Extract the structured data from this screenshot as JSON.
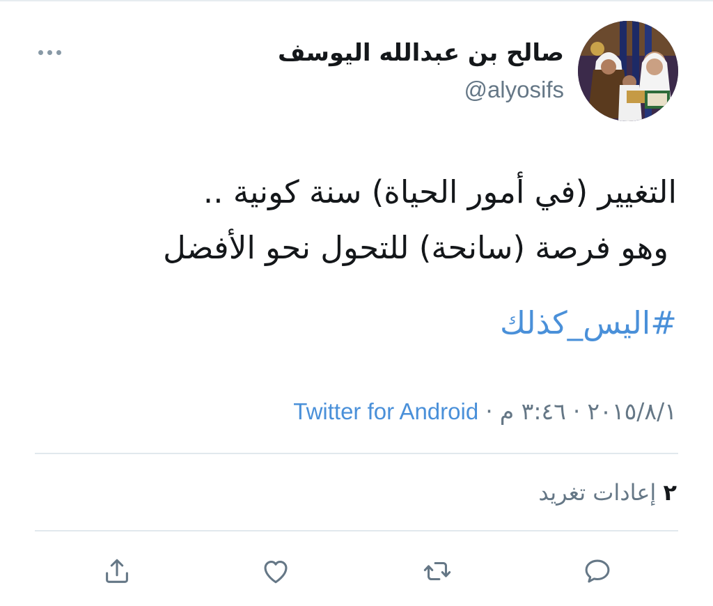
{
  "tweet": {
    "author": {
      "display_name": "صالح بن عبدالله اليوسف",
      "handle": "@alyosifs",
      "avatar_icon": "profile-photo"
    },
    "text_lines": [
      "التغيير (في أمور الحياة) سنة كونية ..",
      "وهو فرصة (سانحة) للتحول نحو الأفضل"
    ],
    "hashtag": "#اليس_كذلك",
    "date": "٢٠١٥/٨/١",
    "time": "٣:٤٦ م",
    "separator": "·",
    "source": "Twitter for Android",
    "retweets": {
      "count": "٢",
      "label": "إعادات تغريد"
    }
  },
  "actions": [
    {
      "name": "reply",
      "icon": "speech-bubble-icon"
    },
    {
      "name": "retweet",
      "icon": "retweet-arrows-icon"
    },
    {
      "name": "like",
      "icon": "heart-icon"
    },
    {
      "name": "share",
      "icon": "share-upload-icon"
    }
  ],
  "colors": {
    "text": "#14171a",
    "secondary": "#657786",
    "link": "#4a90d9",
    "icon": "#657786",
    "divider": "#e1e8ed"
  }
}
